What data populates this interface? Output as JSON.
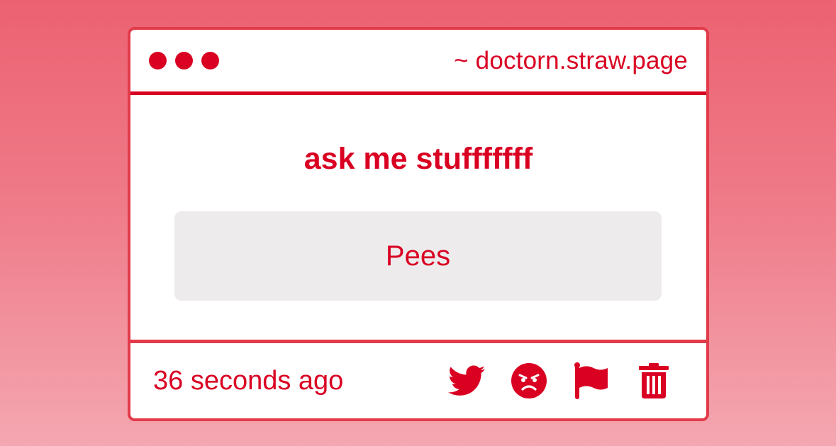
{
  "window": {
    "url": "~ doctorn.straw.page"
  },
  "question": {
    "prompt": "ask me stufffffff",
    "answer": "Pees"
  },
  "footer": {
    "timestamp": "36 seconds ago",
    "actions": [
      "twitter-icon",
      "angry-face-icon",
      "flag-icon",
      "trash-icon"
    ]
  },
  "colors": {
    "accent": "#d90022",
    "border": "#e23b4a",
    "answer_bg": "#edebec"
  }
}
